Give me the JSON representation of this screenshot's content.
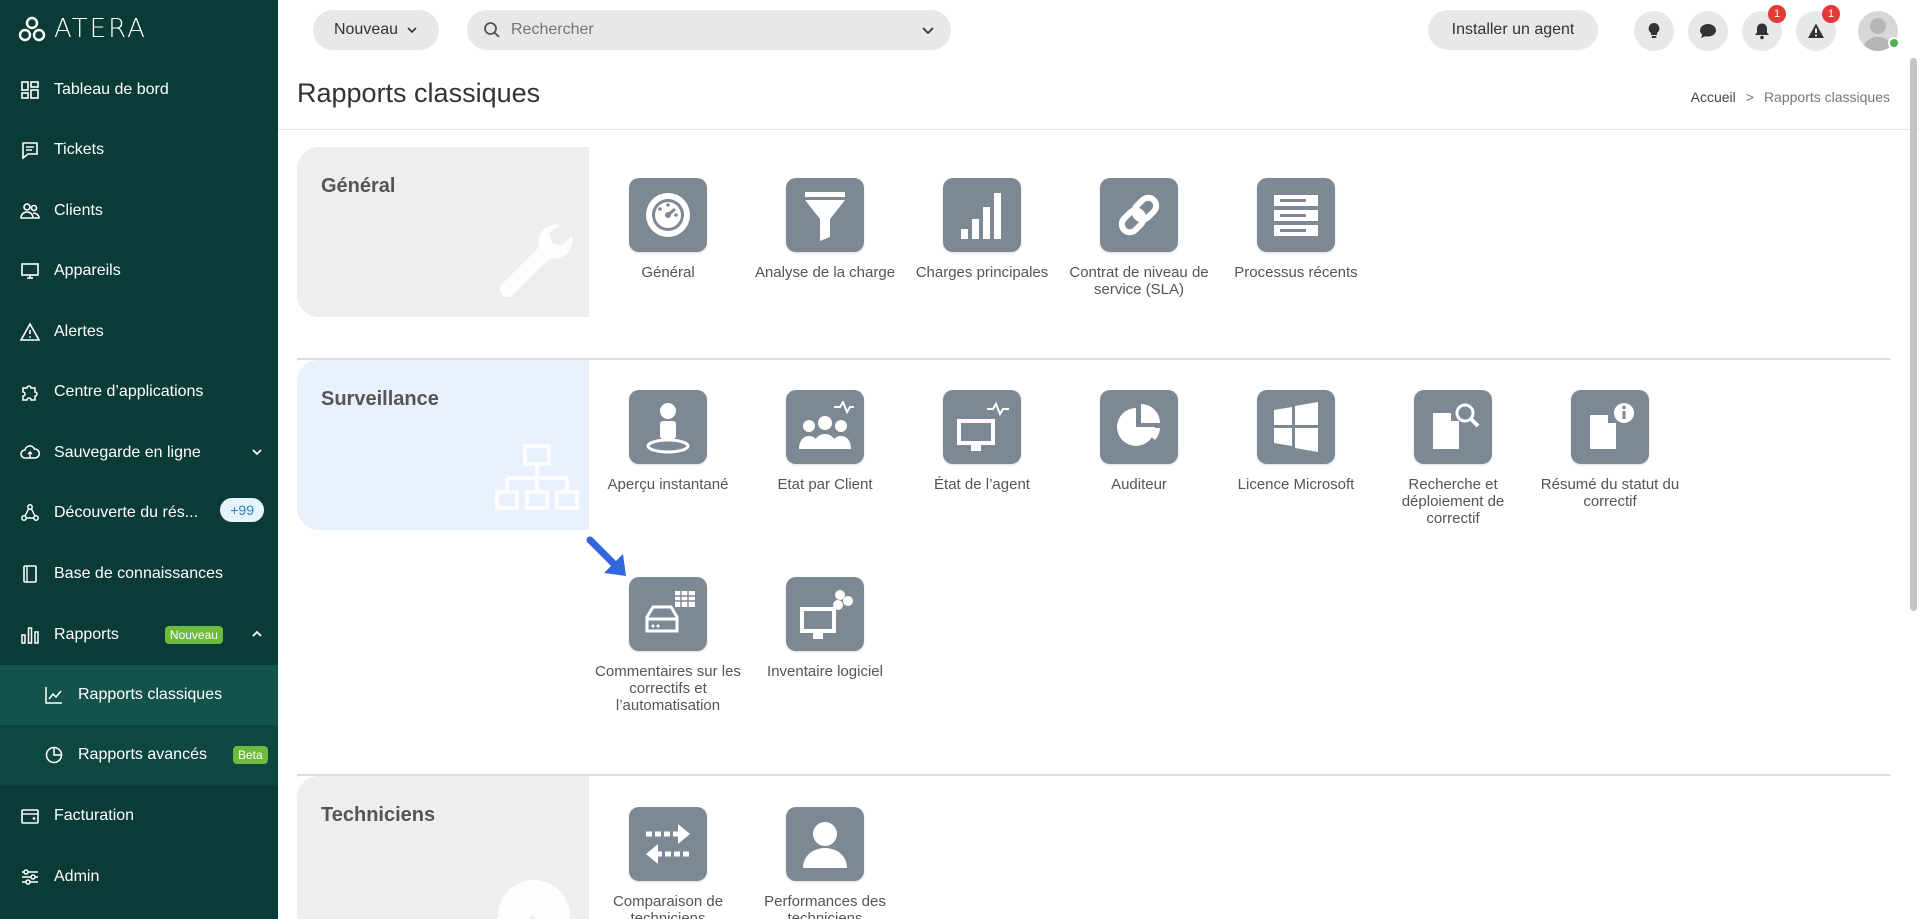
{
  "app": {
    "logo_text": "ATERA"
  },
  "sidebar": {
    "items": [
      {
        "label": "Tableau de bord",
        "icon": "dashboard-icon"
      },
      {
        "label": "Tickets",
        "icon": "ticket-icon"
      },
      {
        "label": "Clients",
        "icon": "clients-icon"
      },
      {
        "label": "Appareils",
        "icon": "monitor-icon"
      },
      {
        "label": "Alertes",
        "icon": "alert-icon"
      },
      {
        "label": "Centre d’applications",
        "icon": "puzzle-icon"
      },
      {
        "label": "Sauvegarde en ligne",
        "icon": "cloud-icon"
      },
      {
        "label": "Découverte du rés...",
        "icon": "network-icon",
        "badge": "+99"
      },
      {
        "label": "Base de connaissances",
        "icon": "book-icon"
      },
      {
        "label": "Rapports",
        "icon": "bar-chart-icon",
        "badge": "Nouveau"
      },
      {
        "label": "Rapports classiques",
        "icon": "trend-icon"
      },
      {
        "label": "Rapports avancés",
        "icon": "pie-icon",
        "badge": "Beta"
      },
      {
        "label": "Facturation",
        "icon": "billing-icon"
      },
      {
        "label": "Admin",
        "icon": "sliders-icon"
      }
    ]
  },
  "topbar": {
    "new_label": "Nouveau",
    "search_placeholder": "Rechercher",
    "install_agent_label": "Installer un agent",
    "notifications_count": "1",
    "alerts_count": "1"
  },
  "page": {
    "title": "Rapports classiques",
    "breadcrumb_home": "Accueil",
    "breadcrumb_sep": ">",
    "breadcrumb_current": "Rapports classiques"
  },
  "sections": [
    {
      "title": "Général",
      "panel_color": "#eeeeec",
      "tiles": [
        {
          "label": "Général",
          "icon": "gauge-icon"
        },
        {
          "label": "Analyse de la charge",
          "icon": "funnel-icon"
        },
        {
          "label": "Charges principales",
          "icon": "signal-bars-icon"
        },
        {
          "label": "Contrat de niveau de service (SLA)",
          "icon": "chain-link-icon"
        },
        {
          "label": "Processus récents",
          "icon": "server-list-icon"
        }
      ]
    },
    {
      "title": "Surveillance",
      "panel_color": "#e9f1fd",
      "tiles": [
        {
          "label": "Aperçu instantané",
          "icon": "person-pin-icon"
        },
        {
          "label": "Etat par Client",
          "icon": "group-heartbeat-icon"
        },
        {
          "label": "État de l’agent",
          "icon": "monitor-heartbeat-icon"
        },
        {
          "label": "Auditeur",
          "icon": "pie-chart-icon"
        },
        {
          "label": "Licence Microsoft",
          "icon": "windows-icon"
        },
        {
          "label": "Recherche et déploiement de correctif",
          "icon": "file-search-icon"
        },
        {
          "label": "Résumé du statut du correctif",
          "icon": "file-info-icon"
        },
        {
          "label": "Commentaires sur les correctifs et l’automatisation",
          "icon": "drive-table-icon"
        },
        {
          "label": "Inventaire logiciel",
          "icon": "monitor-apps-icon"
        }
      ]
    },
    {
      "title": "Techniciens",
      "panel_color": "#eeeeec",
      "tiles": [
        {
          "label": "Comparaison de techniciens",
          "icon": "swap-arrows-icon"
        },
        {
          "label": "Performances des techniciens",
          "icon": "person-icon"
        }
      ]
    }
  ],
  "colors": {
    "sidebar_bg": "#0b3b36",
    "tile_bg": "#7d8895",
    "badge_green": "#6dbb3a",
    "badge_red": "#e53935",
    "arrow_blue": "#3366dd"
  }
}
